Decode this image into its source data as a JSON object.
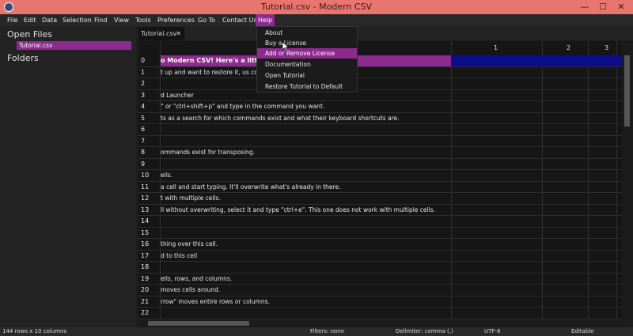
{
  "window": {
    "title": "Tutorial.csv - Modern CSV",
    "minimize": "—",
    "maximize": "☐",
    "close": "✕"
  },
  "menu": {
    "file": "File",
    "edit": "Edit",
    "data": "Data",
    "selection": "Selection",
    "find": "Find",
    "view": "View",
    "tools": "Tools",
    "preferences": "Preferences",
    "goto": "Go To",
    "contact": "Contact Us",
    "help": "Help"
  },
  "sidebar": {
    "open_files": "Open Files",
    "file": "Tutorial.csv",
    "folders": "Folders"
  },
  "tab": {
    "label": "Tutorial.csv",
    "close": "✕"
  },
  "columns": [
    "1",
    "2",
    "3"
  ],
  "rows": [
    {
      "n": "0",
      "t": "o Modern CSV! Here's a little t"
    },
    {
      "n": "1",
      "t": "t up and want to restore it, us                                                                   command and reload it."
    },
    {
      "n": "2",
      "t": ""
    },
    {
      "n": "3",
      "t": "d Launcher"
    },
    {
      "n": "4",
      "t": "\" or \"ctrl+shift+p\" and type in the command you want."
    },
    {
      "n": "5",
      "t": "ts as a search for which commands exist and what their keyboard shortcuts are."
    },
    {
      "n": "6",
      "t": ""
    },
    {
      "n": "7",
      "t": ""
    },
    {
      "n": "8",
      "t": "ommands exist for transposing."
    },
    {
      "n": "9",
      "t": ""
    },
    {
      "n": "10",
      "t": "ells."
    },
    {
      "n": "11",
      "t": "a cell and start typing. It'll overwrite what's already in there."
    },
    {
      "n": "12",
      "t": "t with multiple cells."
    },
    {
      "n": "13",
      "t": "ll without overwriting, select it and type \"ctrl+e\". This one does not work with multiple cells."
    },
    {
      "n": "14",
      "t": ""
    },
    {
      "n": "15",
      "t": ""
    },
    {
      "n": "16",
      "t": "thing over this cell."
    },
    {
      "n": "17",
      "t": "d to this cell"
    },
    {
      "n": "18",
      "t": ""
    },
    {
      "n": "19",
      "t": "ells, rows, and columns."
    },
    {
      "n": "20",
      "t": " moves cells around."
    },
    {
      "n": "21",
      "t": "rrow\" moves entire rows or columns."
    },
    {
      "n": "22",
      "t": ""
    }
  ],
  "help_menu": [
    "About",
    "Buy a License",
    "Add or Remove License",
    "Documentation",
    "Open Tutorial",
    "Restore Tutorial to Default"
  ],
  "status": {
    "size": "144 rows x 10 columns",
    "filters": "Filters: none",
    "delimiter": "Delimiter: comma (,)",
    "encoding": "UTF-8",
    "mode": "Editable"
  }
}
